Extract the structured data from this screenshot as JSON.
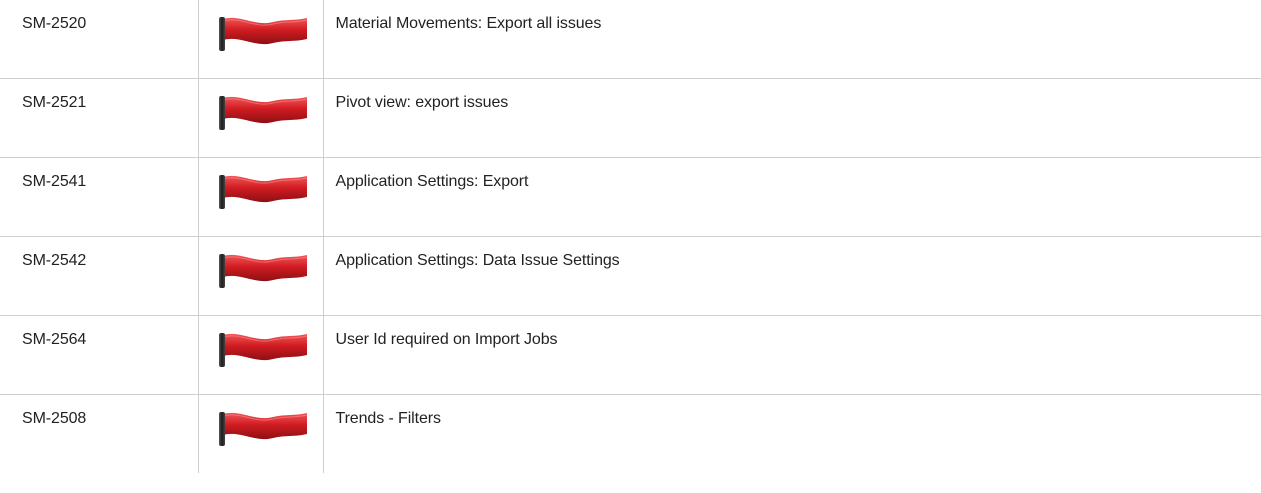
{
  "issues": {
    "rows": [
      {
        "key": "SM-2520",
        "flag_icon": "red-flag-icon",
        "summary": "Material Movements: Export all issues"
      },
      {
        "key": "SM-2521",
        "flag_icon": "red-flag-icon",
        "summary": "Pivot view: export issues"
      },
      {
        "key": "SM-2541",
        "flag_icon": "red-flag-icon",
        "summary": "Application Settings: Export"
      },
      {
        "key": "SM-2542",
        "flag_icon": "red-flag-icon",
        "summary": "Application Settings: Data Issue Settings"
      },
      {
        "key": "SM-2564",
        "flag_icon": "red-flag-icon",
        "summary": "User Id required on Import Jobs"
      },
      {
        "key": "SM-2508",
        "flag_icon": "red-flag-icon",
        "summary": "Trends - Filters"
      }
    ]
  },
  "colors": {
    "flag_red": "#c8161d",
    "flag_pole": "#2b2b2b",
    "grid_line": "#cfcfcf"
  }
}
